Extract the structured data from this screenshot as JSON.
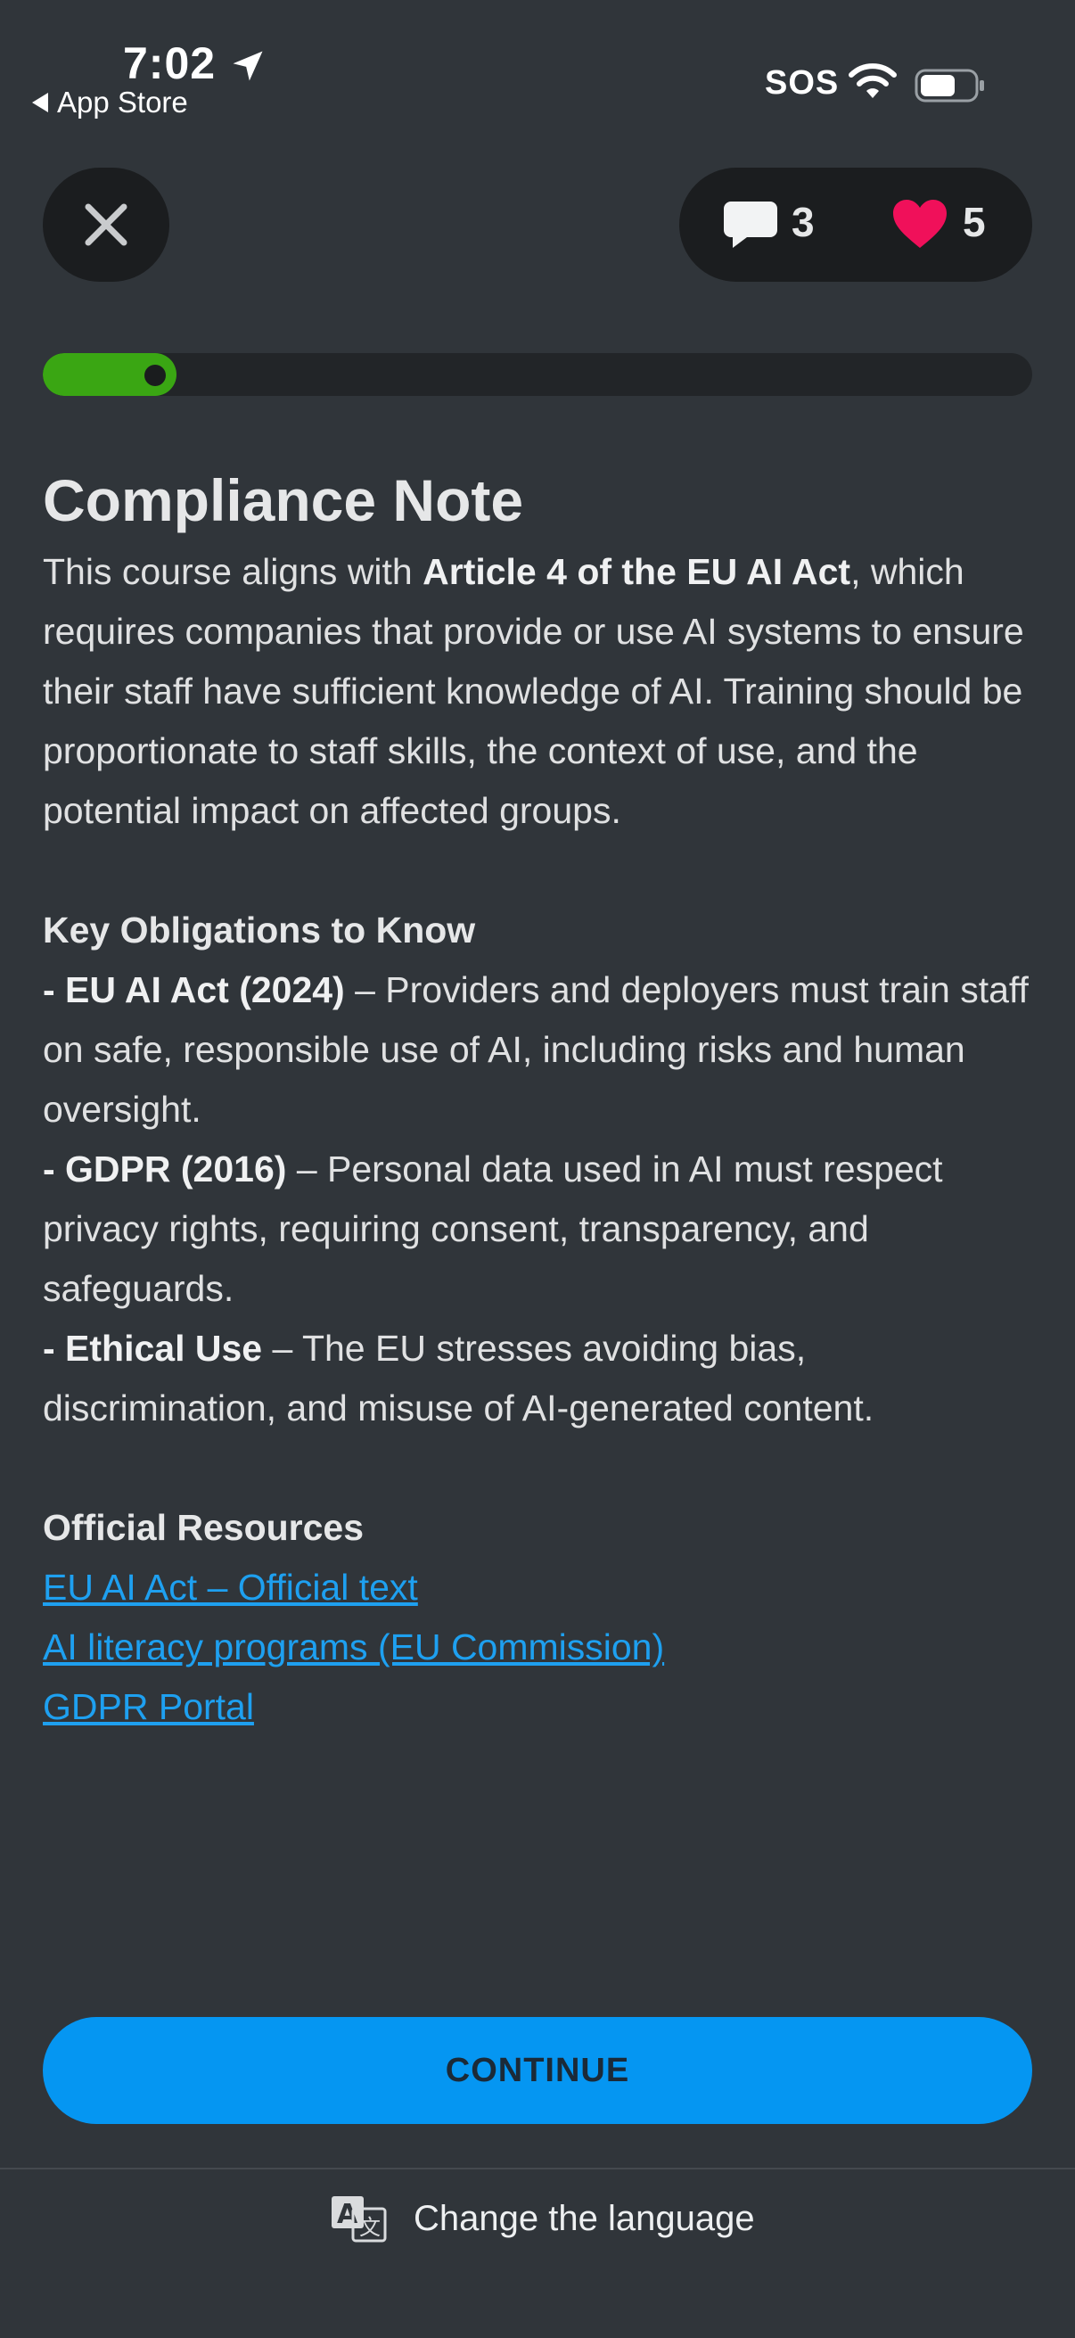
{
  "status_bar": {
    "time": "7:02",
    "back_label": "App Store",
    "carrier": "SOS"
  },
  "header": {
    "comments_count": "3",
    "hearts_count": "5"
  },
  "progress": {
    "fraction": 0.135
  },
  "content": {
    "title": "Compliance Note",
    "intro": {
      "p1": "This course aligns with ",
      "b1": "Article 4 of the EU AI Act",
      "p2": ", which requires companies that provide or use AI systems to ensure their staff have sufficient knowledge of AI. Training should be proportionate to staff skills, the context of use, and the potential impact on affected groups."
    },
    "obligations_heading": "Key Obligations to Know",
    "obligations": [
      {
        "label": "- EU AI Act (2024)",
        "text": " – Providers and deployers must train staff on safe, responsible use of AI, including risks and human oversight."
      },
      {
        "label": "- GDPR (2016)",
        "text": " – Personal data used in AI must respect privacy rights, requiring consent, transparency, and safeguards."
      },
      {
        "label": "- Ethical Use",
        "text": " – The EU stresses avoiding bias, discrimination, and misuse of AI-generated content."
      }
    ],
    "resources_heading": "Official Resources",
    "resources": [
      "EU AI Act – Official text",
      "AI literacy programs (EU Commission)",
      "GDPR Portal"
    ]
  },
  "footer": {
    "continue_label": "CONTINUE",
    "language_label": "Change the language"
  },
  "colors": {
    "background": "#30353a",
    "accent": "#0596f2",
    "progress": "#3aa613",
    "heart": "#f0105a",
    "link": "#1ea0f0"
  }
}
